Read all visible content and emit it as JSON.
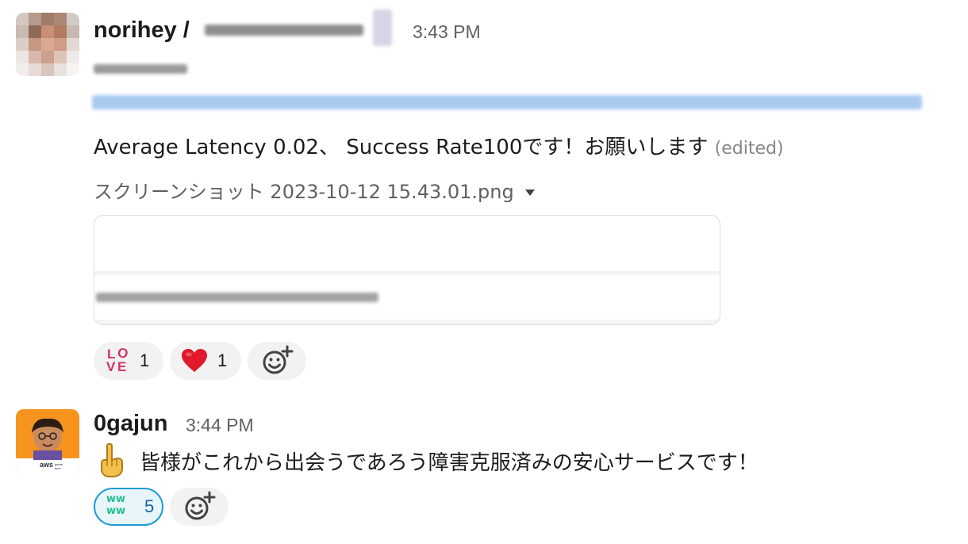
{
  "messages": [
    {
      "author": "norihey /",
      "time": "3:43 PM",
      "text": "Average Latency 0.02、 Success Rate100です！お願いします",
      "edited": "(edited)",
      "attachment": {
        "filename": "スクリーンショット 2023-10-12 15.43.01.png"
      },
      "reactions": [
        {
          "emoji": "love-icon",
          "count": "1"
        },
        {
          "emoji": "heart-icon",
          "count": "1"
        }
      ]
    },
    {
      "author": "0gajun",
      "time": "3:44 PM",
      "text": "皆様がこれから出会うであろう障害克服済みの安心サービスです！",
      "reactions": [
        {
          "emoji": "www-icon",
          "count": "5"
        }
      ]
    }
  ],
  "colors": {
    "name": "#1d1c1d",
    "timestamp": "#616061",
    "link_blur": "#9ec3ef",
    "love": "#d6306a",
    "heart": "#e0192b",
    "www": "#22c08a",
    "active_reaction_border": "#1d9bd1",
    "avatar2_bg": "#f7941d"
  },
  "icons": {
    "add_reaction": "add-reaction-icon",
    "caret": "chevron-down-icon",
    "pointing": "pointing-up-icon"
  }
}
